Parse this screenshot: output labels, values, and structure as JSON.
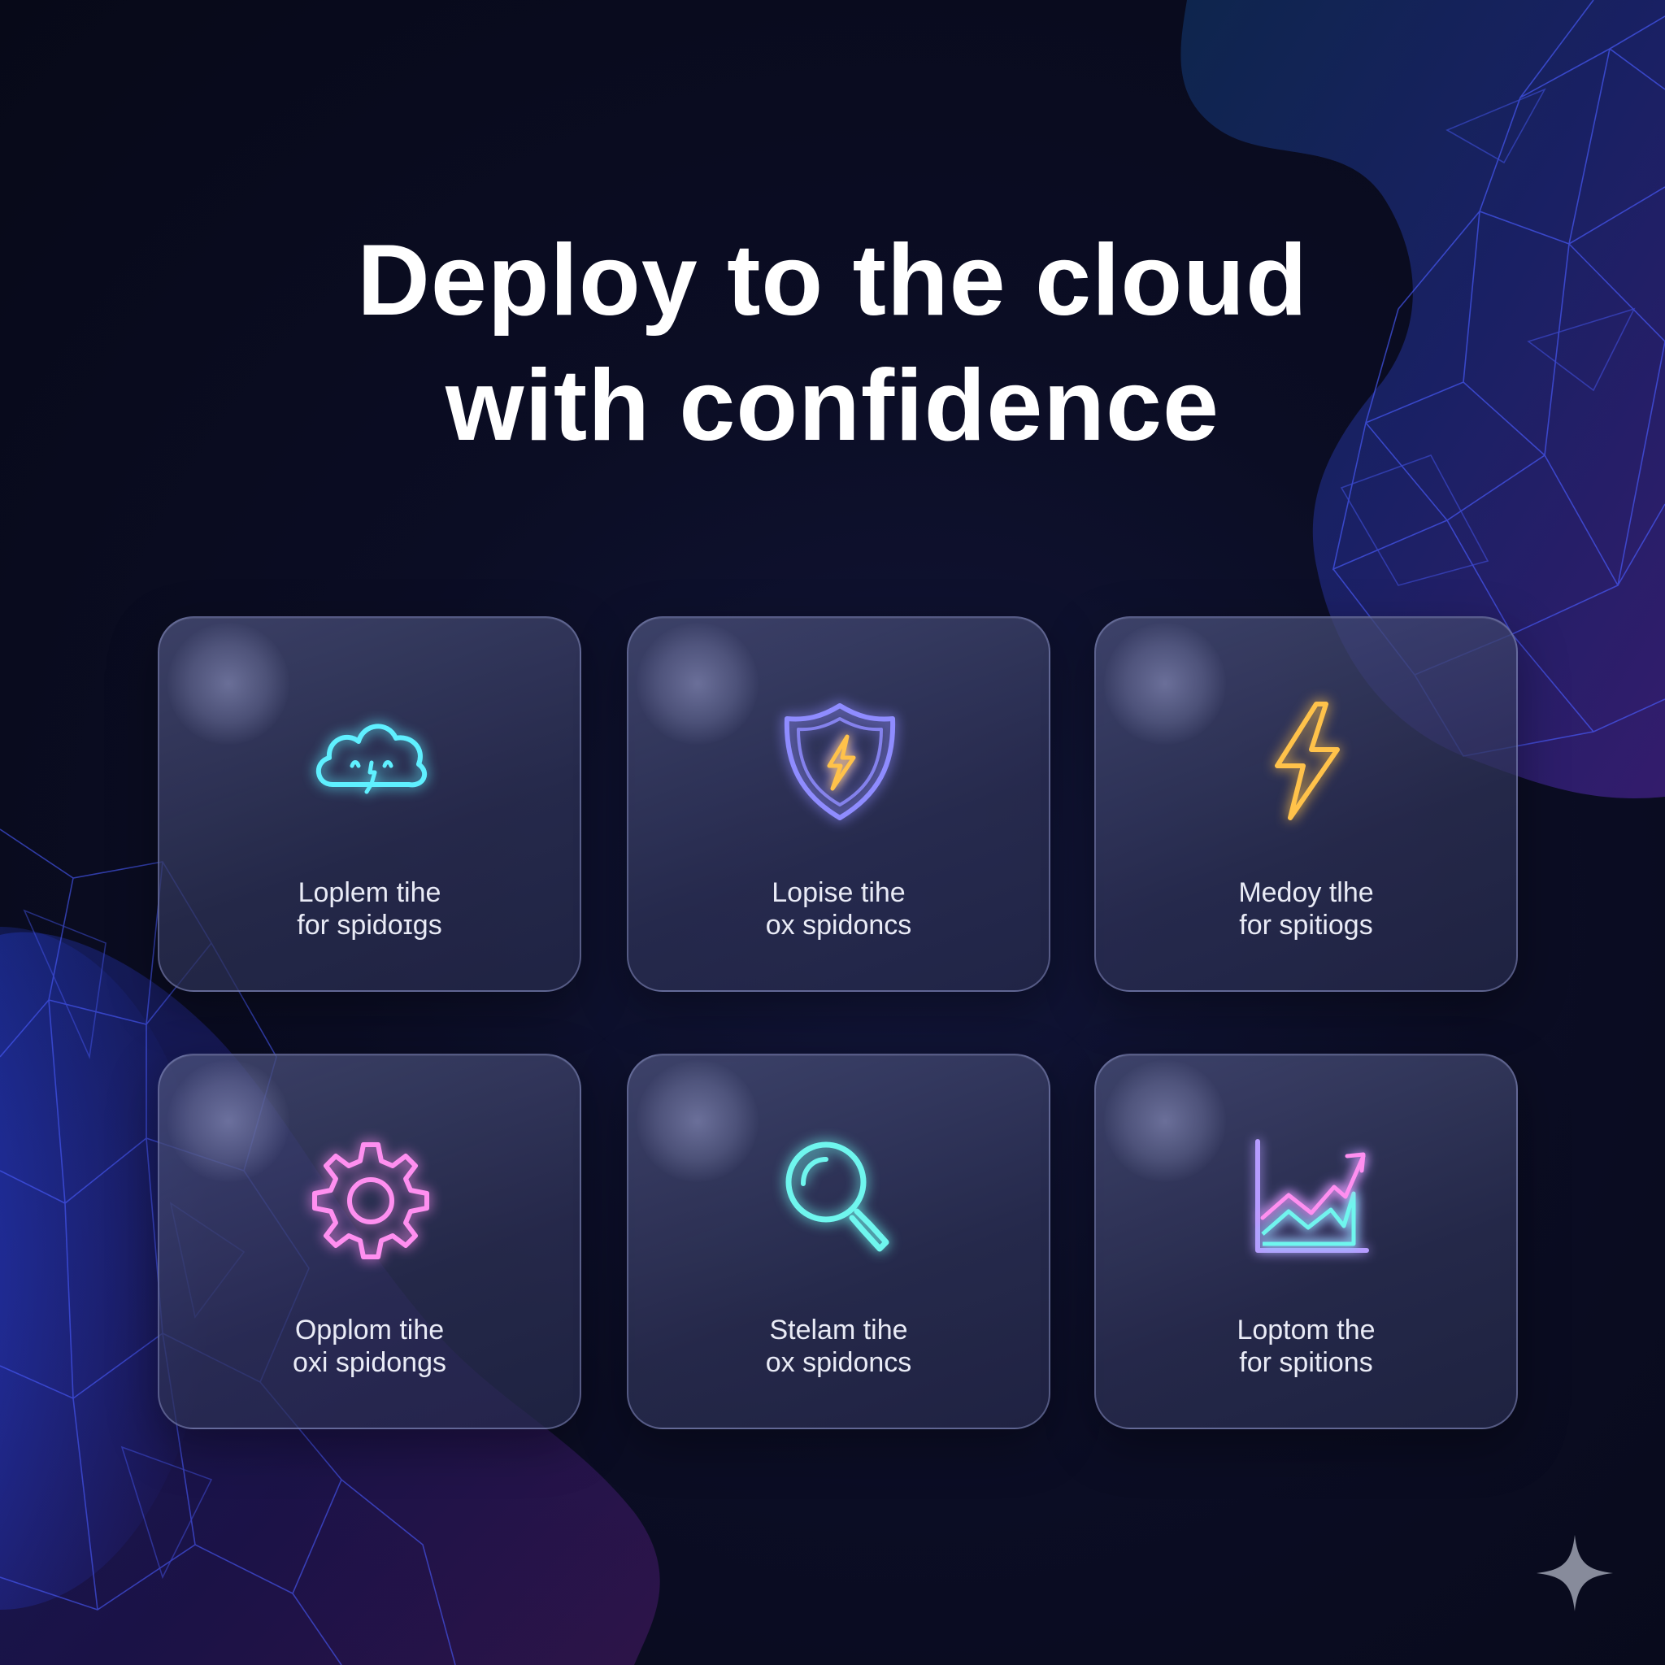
{
  "headline": {
    "line1": "Deploy to the cloud",
    "line2": "with confidence"
  },
  "cards": [
    {
      "icon": "cloud-icon",
      "color": "#5ff0ff",
      "line1": "Loplem tihe",
      "line2": "for spidoɪgs"
    },
    {
      "icon": "shield-bolt-icon",
      "color": "#8f8cff",
      "accent": "#ffc24a",
      "line1": "Lopise tihe",
      "line2": "ox spidoncs"
    },
    {
      "icon": "lightning-bolt-icon",
      "color": "#ffc24a",
      "line1": "Medoy tlhe",
      "line2": "for spitiogs"
    },
    {
      "icon": "gear-icon",
      "color": "#ff8ff0",
      "line1": "Opplom tihe",
      "line2": "oxi spidongs"
    },
    {
      "icon": "magnifier-icon",
      "color": "#6ff6ee",
      "line1": "Stelam tihe",
      "line2": "ox spidoncs"
    },
    {
      "icon": "line-chart-icon",
      "color": "#b69cff",
      "accent": "#ff8ff0",
      "line1": "Loptom the",
      "line2": "for spitions"
    }
  ],
  "colors": {
    "background": "#0b0d24",
    "card_border": "#969ed2",
    "text": "#ffffff",
    "mesh_blue": "#3a5cff",
    "mesh_purple": "#8a4cff"
  },
  "decor": {
    "sparkle": "sparkle-icon"
  }
}
